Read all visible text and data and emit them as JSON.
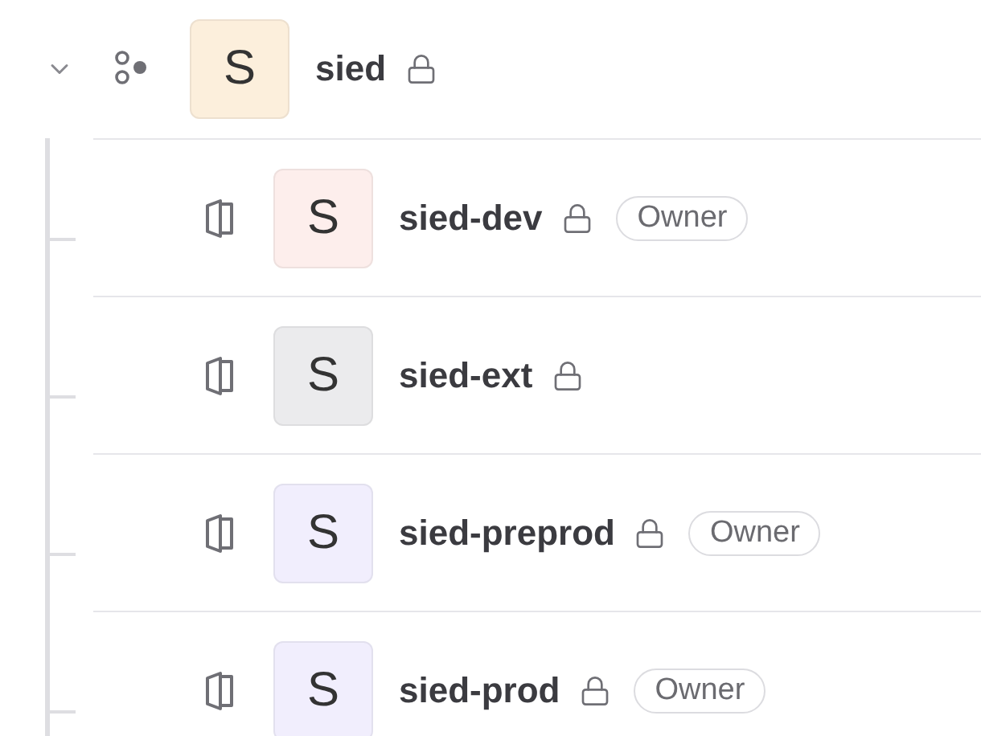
{
  "project": {
    "expanded": true,
    "initial": "S",
    "name": "sied",
    "color": "#fcefdc",
    "locked": true,
    "children": [
      {
        "initial": "S",
        "name": "sied-dev",
        "color": "#fdeeec",
        "locked": true,
        "badge": "Owner"
      },
      {
        "initial": "S",
        "name": "sied-ext",
        "color": "#ebebed",
        "locked": true
      },
      {
        "initial": "S",
        "name": "sied-preprod",
        "color": "#f1eefd",
        "locked": true,
        "badge": "Owner"
      },
      {
        "initial": "S",
        "name": "sied-prod",
        "color": "#f1eefd",
        "locked": true,
        "badge": "Owner"
      }
    ]
  }
}
